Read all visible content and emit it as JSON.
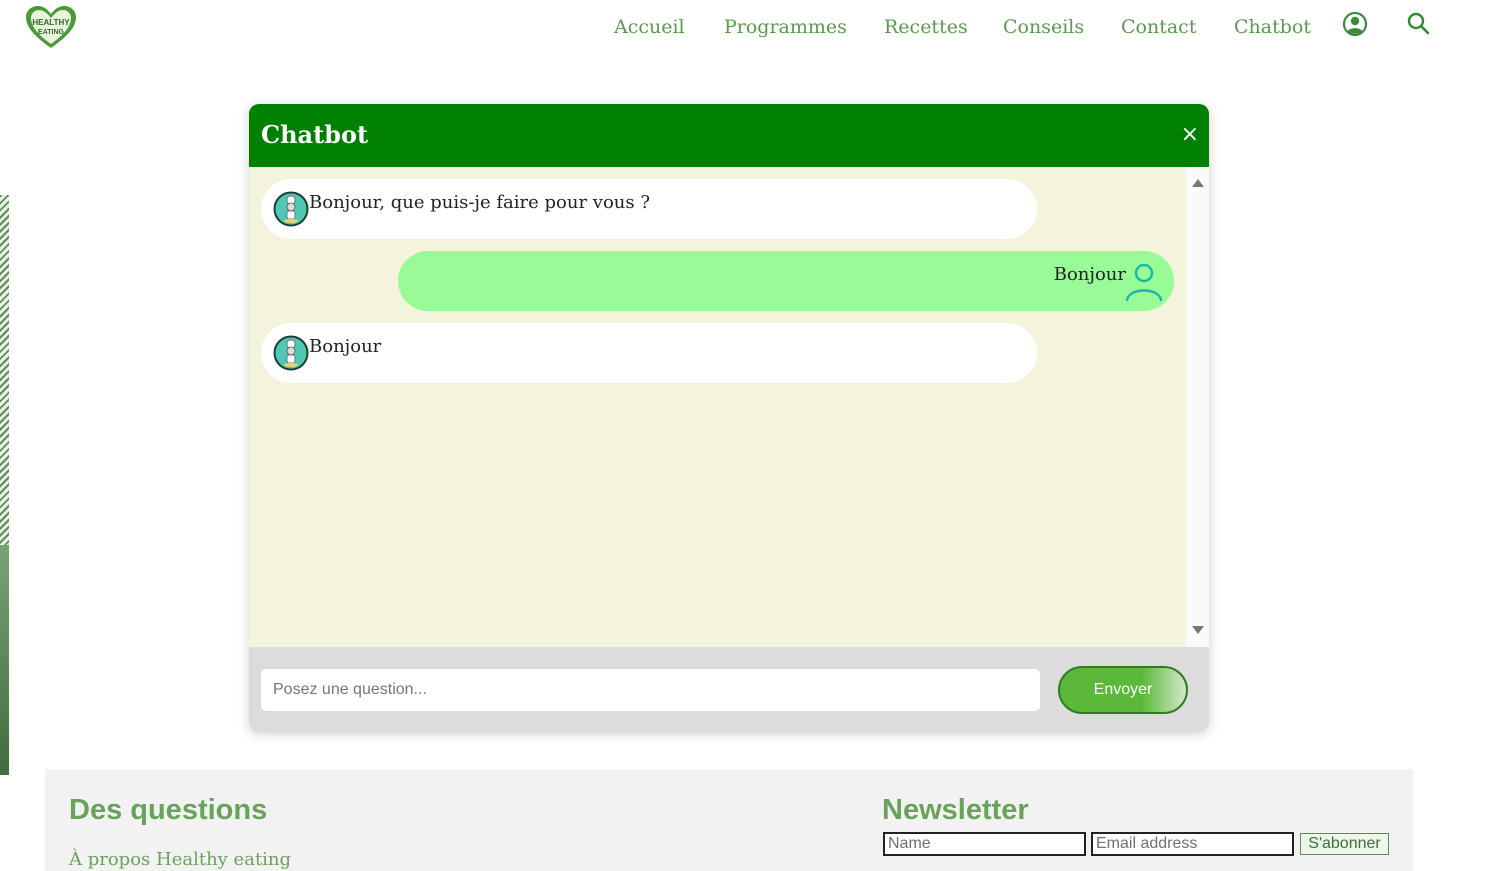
{
  "header": {
    "logo_text_line1": "HEALTHY",
    "logo_text_line2": "EATING",
    "nav": [
      "Accueil",
      "Programmes",
      "Recettes",
      "Conseils",
      "Contact",
      "Chatbot"
    ],
    "icons": [
      "user-circle-icon",
      "search-icon"
    ],
    "link_color": "#5a9a4d"
  },
  "chatbot": {
    "title": "Chatbot",
    "close_label": "×",
    "header_color": "#008000",
    "body_color": "#f4f4dc",
    "messages": [
      {
        "sender": "bot",
        "text": "Bonjour, que puis-je faire pour vous ?"
      },
      {
        "sender": "user",
        "text": "Bonjour"
      },
      {
        "sender": "bot",
        "text": "Bonjour"
      }
    ],
    "input_placeholder": "Posez une question...",
    "send_label": "Envoyer",
    "user_bubble_color": "#98fb98"
  },
  "footer": {
    "questions_heading": "Des questions",
    "about_link": "À propos Healthy eating",
    "newsletter_heading": "Newsletter",
    "name_placeholder": "Name",
    "email_placeholder": "Email address",
    "subscribe_label": "S'abonner",
    "heading_color": "#6aa25b"
  }
}
